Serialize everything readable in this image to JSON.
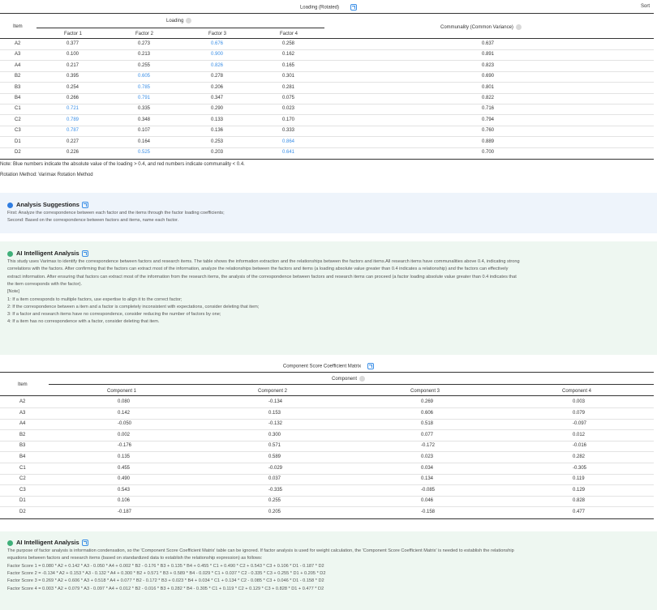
{
  "t1": {
    "title": "Loading (Rotated)",
    "sort": "Sort",
    "item_header": "Item",
    "loading_header": "Loading",
    "communality_header": "Communality (Common Variance)",
    "factors": [
      "Factor 1",
      "Factor 2",
      "Factor 3",
      "Factor 4"
    ],
    "rows": [
      {
        "item": "A2",
        "vals": [
          "0.377",
          "0.273",
          "0.676",
          "0.258"
        ],
        "blue": [
          false,
          false,
          true,
          false
        ],
        "comm": "0.637"
      },
      {
        "item": "A3",
        "vals": [
          "0.100",
          "0.213",
          "0.900",
          "0.162"
        ],
        "blue": [
          false,
          false,
          true,
          false
        ],
        "comm": "0.891"
      },
      {
        "item": "A4",
        "vals": [
          "0.217",
          "0.255",
          "0.826",
          "0.165"
        ],
        "blue": [
          false,
          false,
          true,
          false
        ],
        "comm": "0.823"
      },
      {
        "item": "B2",
        "vals": [
          "0.395",
          "0.605",
          "0.278",
          "0.301"
        ],
        "blue": [
          false,
          true,
          false,
          false
        ],
        "comm": "0.690"
      },
      {
        "item": "B3",
        "vals": [
          "0.254",
          "0.785",
          "0.206",
          "0.281"
        ],
        "blue": [
          false,
          true,
          false,
          false
        ],
        "comm": "0.801"
      },
      {
        "item": "B4",
        "vals": [
          "0.266",
          "0.791",
          "0.347",
          "0.075"
        ],
        "blue": [
          false,
          true,
          false,
          false
        ],
        "comm": "0.822"
      },
      {
        "item": "C1",
        "vals": [
          "0.721",
          "0.335",
          "0.290",
          "0.023"
        ],
        "blue": [
          true,
          false,
          false,
          false
        ],
        "comm": "0.716"
      },
      {
        "item": "C2",
        "vals": [
          "0.789",
          "0.348",
          "0.133",
          "0.170"
        ],
        "blue": [
          true,
          false,
          false,
          false
        ],
        "comm": "0.794"
      },
      {
        "item": "C3",
        "vals": [
          "0.787",
          "0.107",
          "0.136",
          "0.333"
        ],
        "blue": [
          true,
          false,
          false,
          false
        ],
        "comm": "0.760"
      },
      {
        "item": "D1",
        "vals": [
          "0.227",
          "0.164",
          "0.253",
          "0.864"
        ],
        "blue": [
          false,
          false,
          false,
          true
        ],
        "comm": "0.889"
      },
      {
        "item": "D2",
        "vals": [
          "0.226",
          "0.525",
          "0.203",
          "0.641"
        ],
        "blue": [
          false,
          true,
          false,
          true
        ],
        "comm": "0.700"
      }
    ],
    "note1": "Note: Blue numbers indicate the absolute value of the loading > 0.4, and red numbers indicate communality < 0.4.",
    "note2": "Rotation Method: Varimax Rotation Method"
  },
  "suggest": {
    "title": "Analysis Suggestions",
    "lines": [
      "First: Analyze the correspondence between each factor and the items through the factor loading coefficients;",
      "Second: Based on the correspondence between factors and items, name each factor."
    ]
  },
  "ai1": {
    "title": "AI Intelligent Analysis",
    "lines": [
      "This study uses Varimax to identify the correspondence between factors and research items. The table shows the information extraction and the relationships between the factors and items.All research items have communalities above 0.4, indicating strong",
      "correlations with the factors. After confirming that the factors can extract most of the information, analyze the relationships between the factors and items (a loading absolute value greater than 0.4 indicates a relationship) and the factors can effectively",
      "extract information. After ensuring that factors can extract most of the information from the research items, the analysis of the correspondence between factors and research items can proceed (a factor loading absolute value greater than 0.4 indicates that",
      "the item corresponds with the factor).",
      "[Note]",
      "1: If a item corresponds to multiple factors, use expertise to align it to the correct factor;",
      "2: If the correspondence between a item and a factor is completely inconsistent with expectations, consider deleting that item;",
      "3: If a factor and research items have no correspondence, consider reducing the number of factors by one;",
      "4: If a item has no correspondence with a factor, consider deleting that item."
    ]
  },
  "t2": {
    "title": "Component Score Coefficient Matrix",
    "item_header": "Item",
    "component_header": "Component",
    "components": [
      "Component 1",
      "Component 2",
      "Component 3",
      "Component 4"
    ],
    "rows": [
      {
        "item": "A2",
        "vals": [
          "0.080",
          "-0.134",
          "0.269",
          "0.003"
        ]
      },
      {
        "item": "A3",
        "vals": [
          "0.142",
          "0.153",
          "0.606",
          "0.079"
        ]
      },
      {
        "item": "A4",
        "vals": [
          "-0.050",
          "-0.132",
          "0.518",
          "-0.097"
        ]
      },
      {
        "item": "B2",
        "vals": [
          "0.002",
          "0.300",
          "0.077",
          "0.012"
        ]
      },
      {
        "item": "B3",
        "vals": [
          "-0.176",
          "0.571",
          "-0.172",
          "-0.016"
        ]
      },
      {
        "item": "B4",
        "vals": [
          "0.135",
          "0.589",
          "0.023",
          "0.282"
        ]
      },
      {
        "item": "C1",
        "vals": [
          "0.455",
          "-0.029",
          "0.034",
          "-0.305"
        ]
      },
      {
        "item": "C2",
        "vals": [
          "0.490",
          "0.037",
          "0.134",
          "0.119"
        ]
      },
      {
        "item": "C3",
        "vals": [
          "0.543",
          "-0.335",
          "-0.085",
          "0.129"
        ]
      },
      {
        "item": "D1",
        "vals": [
          "0.106",
          "0.255",
          "0.046",
          "0.828"
        ]
      },
      {
        "item": "D2",
        "vals": [
          "-0.187",
          "0.205",
          "-0.158",
          "0.477"
        ]
      }
    ]
  },
  "ai2": {
    "title": "AI Intelligent Analysis",
    "lines": [
      "The purpose of factor analysis is information condensation, so the 'Component Score Coefficient Matrix' table can be ignored. If factor analysis is used for weight calculation, the 'Component Score Coefficient Matrix' is needed to establish the relationship",
      "equations between factors and research items (based on standardized data to establish the relationship expression) as follows:",
      "Factor Score 1 = 0.080 * A2 + 0.142 * A3 - 0.050 * A4 + 0.002 * B2 - 0.176 * B3 + 0.135 * B4 + 0.455 * C1 + 0.490 * C2 + 0.543 * C3 + 0.106 * D1 - 0.187 * D2",
      "Factor Score 2 = -0.134 * A2 + 0.153 * A3 - 0.132 * A4 + 0.300 * B2 + 0.571 * B3 + 0.589 * B4 - 0.029 * C1 + 0.037 * C2 - 0.335 * C3 + 0.255 * D1 + 0.205 * D2",
      "Factor Score 3 = 0.269 * A2 + 0.606 * A3 + 0.518 * A4 + 0.077 * B2 - 0.172 * B3 + 0.023 * B4 + 0.034 * C1 + 0.134 * C2 - 0.085 * C3 + 0.046 * D1 - 0.158 * D2",
      "Factor Score 4 = 0.003 * A2 + 0.079 * A3 - 0.097 * A4 + 0.012 * B2 - 0.016 * B3 + 0.282 * B4 - 0.305 * C1 + 0.119 * C2 + 0.129 * C3 + 0.828 * D1 + 0.477 * D2"
    ]
  }
}
